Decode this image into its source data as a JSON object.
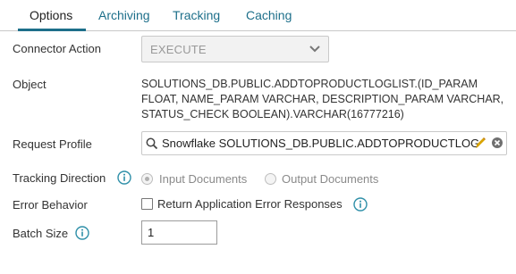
{
  "tabs": [
    {
      "label": "Options",
      "active": true
    },
    {
      "label": "Archiving",
      "active": false
    },
    {
      "label": "Tracking",
      "active": false
    },
    {
      "label": "Caching",
      "active": false
    }
  ],
  "fields": {
    "connector_action": {
      "label": "Connector Action",
      "value": "EXECUTE"
    },
    "object": {
      "label": "Object",
      "lines": [
        "SOLUTIONS_DB.PUBLIC.ADDTOPRODUCTLOGLIST.(ID_PARAM",
        "FLOAT, NAME_PARAM VARCHAR, DESCRIPTION_PARAM VARCHAR,",
        "STATUS_CHECK BOOLEAN).VARCHAR(16777216)"
      ]
    },
    "request_profile": {
      "label": "Request Profile",
      "value": "Snowflake SOLUTIONS_DB.PUBLIC.ADDTOPRODUCTLOG"
    },
    "tracking_direction": {
      "label": "Tracking Direction",
      "options": [
        {
          "label": "Input Documents",
          "selected": true
        },
        {
          "label": "Output Documents",
          "selected": false
        }
      ]
    },
    "error_behavior": {
      "label": "Error Behavior",
      "checkbox_label": "Return Application Error Responses",
      "checked": false
    },
    "batch_size": {
      "label": "Batch Size",
      "value": "1"
    }
  },
  "colors": {
    "accent": "#1d6f8a",
    "info_icon": "#2e8fa8",
    "edit_icon": "#d9a400"
  },
  "icons": {
    "select_arrow": "chevron-down-icon",
    "profile_search": "search-icon",
    "profile_edit": "pencil-icon",
    "profile_clear": "clear-icon",
    "info": "info-icon"
  }
}
